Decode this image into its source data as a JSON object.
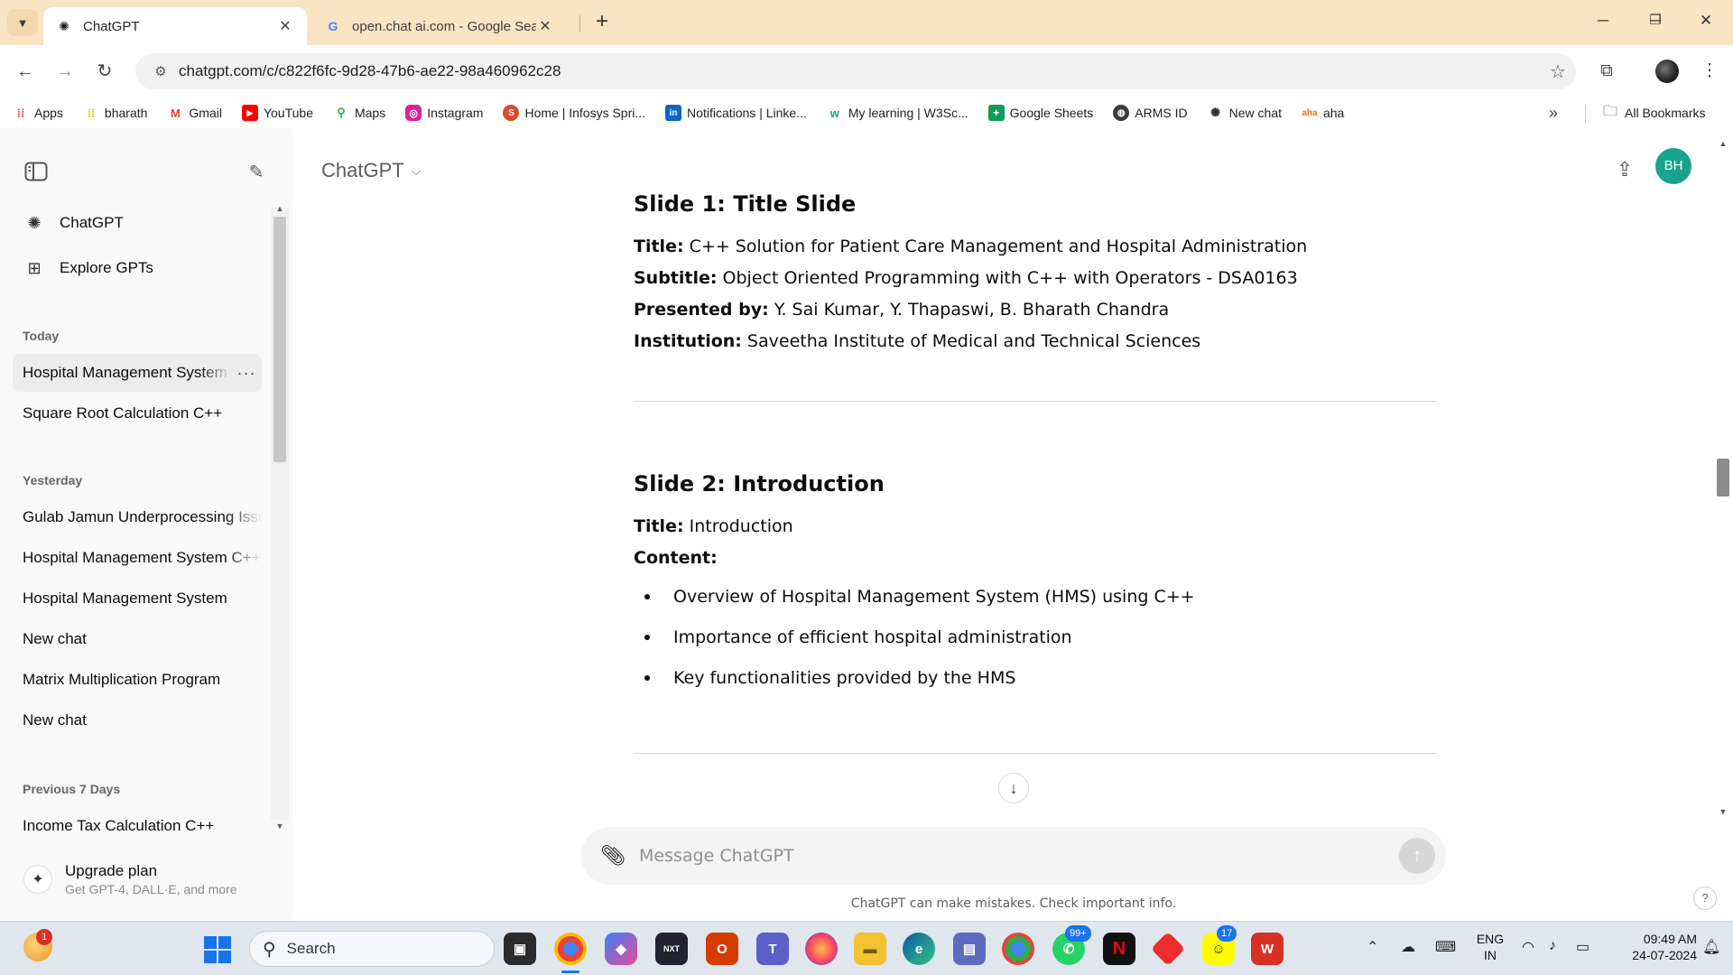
{
  "browser": {
    "tabs": [
      {
        "title": "ChatGPT",
        "close": "✕"
      },
      {
        "title": "open.chat ai.com - Google Sear",
        "close": "✕"
      }
    ],
    "new_tab": "+",
    "url": "chatgpt.com/c/c822f6fc-9d28-47b6-ae22-98a460962c28",
    "bookmarks": [
      {
        "label": "Apps",
        "icon": "apps-grid-icon"
      },
      {
        "label": "bharath",
        "icon": "apps-grid-icon"
      },
      {
        "label": "Gmail",
        "icon": "gmail-icon"
      },
      {
        "label": "YouTube",
        "icon": "youtube-icon"
      },
      {
        "label": "Maps",
        "icon": "maps-pin-icon"
      },
      {
        "label": "Instagram",
        "icon": "instagram-icon"
      },
      {
        "label": "Home | Infosys Spri...",
        "icon": "infosys-icon"
      },
      {
        "label": "Notifications | Linke...",
        "icon": "linkedin-icon"
      },
      {
        "label": "My learning | W3Sc...",
        "icon": "w3schools-icon"
      },
      {
        "label": "Google Sheets",
        "icon": "sheets-icon"
      },
      {
        "label": "ARMS ID",
        "icon": "globe-icon"
      },
      {
        "label": "New chat",
        "icon": "openai-icon"
      },
      {
        "label": "aha",
        "icon": "aha-icon"
      }
    ],
    "all_bookmarks": "All Bookmarks"
  },
  "sidebar": {
    "nav": [
      {
        "label": "ChatGPT",
        "icon": "openai-icon"
      },
      {
        "label": "Explore GPTs",
        "icon": "grid-icon"
      }
    ],
    "sections": [
      {
        "title": "Today",
        "items": [
          "Hospital Management System",
          "Square Root Calculation C++"
        ]
      },
      {
        "title": "Yesterday",
        "items": [
          "Gulab Jamun Underprocessing Issue",
          "Hospital Management System C++",
          "Hospital Management System",
          "New chat",
          "Matrix Multiplication Program",
          "New chat"
        ]
      },
      {
        "title": "Previous 7 Days",
        "items": [
          "Income Tax Calculation C++"
        ]
      }
    ],
    "active_item_dots": "···",
    "upgrade": {
      "title": "Upgrade plan",
      "subtitle": "Get GPT-4, DALL·E, and more"
    }
  },
  "header": {
    "model": "ChatGPT",
    "avatar": "BH"
  },
  "conversation": {
    "slide1": {
      "heading": "Slide 1: Title Slide",
      "lines": [
        {
          "key": "Title:",
          "value": " C++ Solution for Patient Care Management and Hospital Administration"
        },
        {
          "key": "Subtitle:",
          "value": " Object Oriented Programming with C++ with Operators - DSA0163"
        },
        {
          "key": "Presented by:",
          "value": " Y. Sai Kumar, Y. Thapaswi, B. Bharath Chandra"
        },
        {
          "key": "Institution:",
          "value": " Saveetha Institute of Medical and Technical Sciences"
        }
      ]
    },
    "slide2": {
      "heading": "Slide 2: Introduction",
      "lines": [
        {
          "key": "Title:",
          "value": " Introduction"
        },
        {
          "key": "Content:",
          "value": ""
        }
      ],
      "bullets": [
        "Overview of Hospital Management System (HMS) using C++",
        "Importance of efficient hospital administration",
        "Key functionalities provided by the HMS"
      ]
    }
  },
  "composer": {
    "placeholder": "Message ChatGPT",
    "disclaimer": "ChatGPT can make mistakes. Check important info.",
    "help": "?"
  },
  "taskbar": {
    "weather_badge": "1",
    "search_label": "Search",
    "whatsapp_badge": "99+",
    "notif_badge": "17",
    "lang_top": "ENG",
    "lang_bottom": "IN",
    "time": "09:49 AM",
    "date": "24-07-2024"
  },
  "colors": {
    "avatar": "#19a38e",
    "tabstrip": "#f9e4c3",
    "sidebar": "#f9f9f9"
  }
}
